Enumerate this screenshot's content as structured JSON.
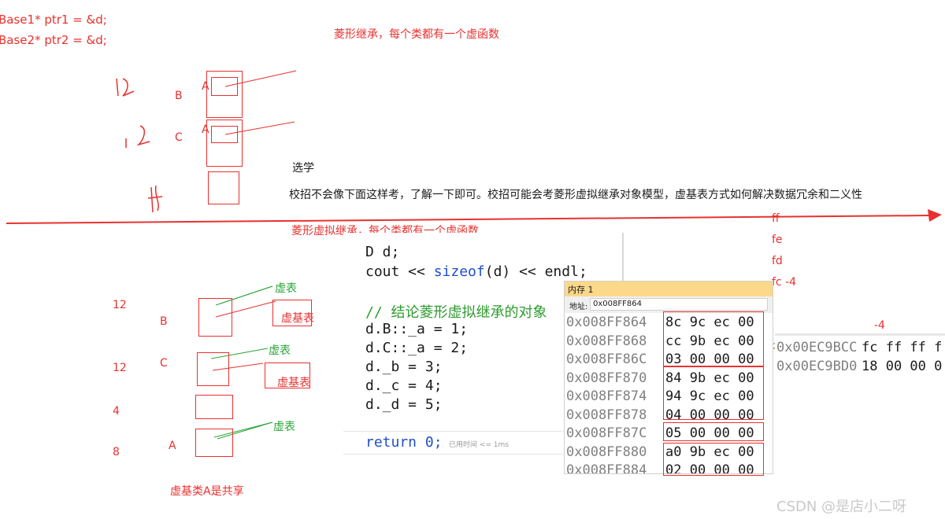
{
  "top_left": {
    "line1": "Base1* ptr1 = &d;",
    "line2": "Base2* ptr2 = &d;"
  },
  "title_top": "菱形继承，每个类都有一个虚函数",
  "top_labels": {
    "b": "B",
    "c": "C",
    "a1": "A",
    "a2": "A"
  },
  "notes": {
    "head": "选学",
    "body": "校招不会像下面这样考，了解一下即可。校招可能会考菱形虚拟继承对象模型，虚基表方式如何解决数据冗余和二义性"
  },
  "title_bottom": "菱形虚拟继承，每个类都有一个虚函数",
  "bottom_labels": {
    "size_b": "12",
    "size_c": "12",
    "size_d": "4",
    "size_a": "8",
    "b": "B",
    "c": "C",
    "a": "A",
    "vtable1": "虚表",
    "vtable2": "虚表",
    "vtable3": "虚表",
    "vbtable1": "虚基表",
    "vbtable2": "虚基表",
    "shared": "虚基类A是共享"
  },
  "right_notes": {
    "ff": "ff",
    "fe": "fe",
    "fd": "fd",
    "fc": "fc  -4",
    "m4": "-4"
  },
  "code": {
    "l1": "D d;",
    "l2_a": "cout << ",
    "l2_kw": "sizeof",
    "l2_b": "(d) << endl;",
    "comment": "// 结论菱形虚拟继承的对象",
    "l3": "d.B::_a = 1;",
    "l4": "d.C::_a = 2;",
    "l5": "d._b = 3;",
    "l6": "d._c = 4;",
    "l7": "d._d = 5;",
    "ret": "return 0;",
    "elapsed": "已用时间 <= 1ms"
  },
  "memory": {
    "title": "内存 1",
    "addr_label": "地址:",
    "addr_value": "0x008FF864",
    "rows": [
      {
        "addr": "0x008FF864",
        "bytes": "8c 9c ec 00"
      },
      {
        "addr": "0x008FF868",
        "bytes": "cc 9b ec 00"
      },
      {
        "addr": "0x008FF86C",
        "bytes": "03 00 00 00"
      },
      {
        "addr": "0x008FF870",
        "bytes": "84 9b ec 00"
      },
      {
        "addr": "0x008FF874",
        "bytes": "94 9c ec 00"
      },
      {
        "addr": "0x008FF878",
        "bytes": "04 00 00 00"
      },
      {
        "addr": "0x008FF87C",
        "bytes": "05 00 00 00"
      },
      {
        "addr": "0x008FF880",
        "bytes": "a0 9b ec 00"
      },
      {
        "addr": "0x008FF884",
        "bytes": "02 00 00 00"
      }
    ]
  },
  "memory2": {
    "rows": [
      {
        "addr": "0x00EC9BCC",
        "bytes": "fc ff ff f"
      },
      {
        "addr": "0x00EC9BD0",
        "bytes": "18 00 00 0"
      }
    ]
  },
  "watermark": "CSDN @是店小二呀"
}
